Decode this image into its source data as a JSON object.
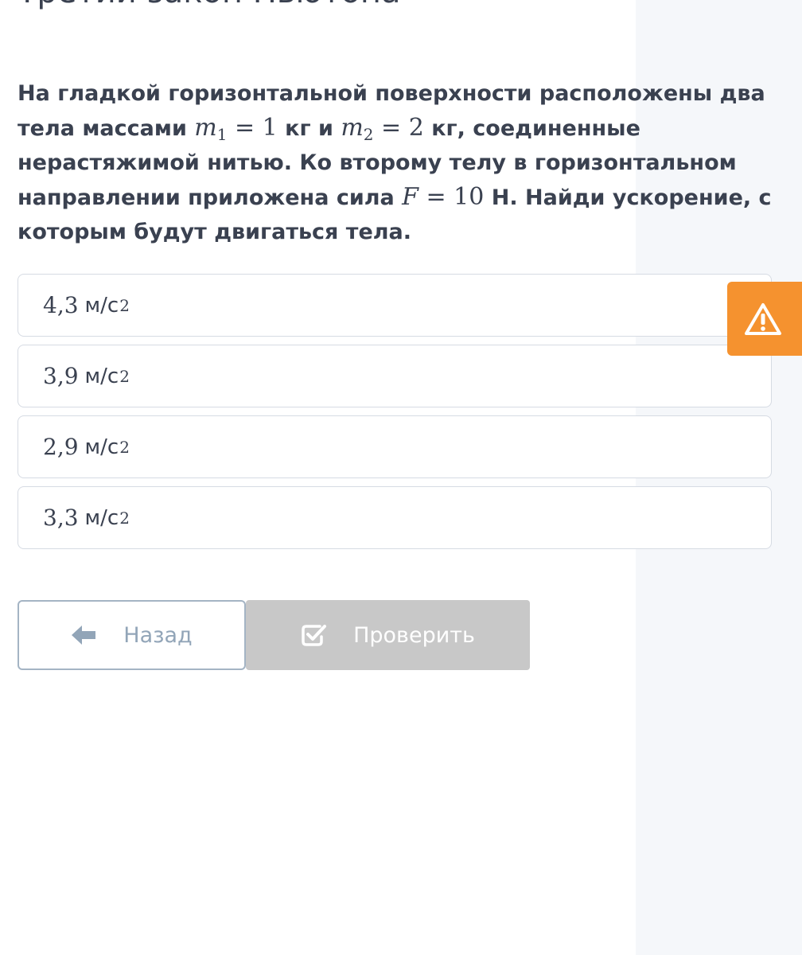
{
  "lesson": {
    "title": "Третий закон Ньютона"
  },
  "question": {
    "text_1": "На гладкой горизонтальной поверхности расположены два тела массами ",
    "m1_var": "m",
    "m1_sub": "1",
    "m1_eq": " = 1",
    "m1_unit": " кг и ",
    "m2_var": "m",
    "m2_sub": "2",
    "m2_eq": " = 2",
    "text_2": " кг, соединенные нерастяжимой нитью. Ко второму телу в горизонтальном направлении приложена сила ",
    "f_var": "F",
    "f_eq": " = 10",
    "text_3": " Н. Найди ускорение, с которым будут двигаться тела."
  },
  "options": [
    {
      "value": "4,3",
      "unit": "м/с",
      "power": "2"
    },
    {
      "value": "3,9",
      "unit": "м/с",
      "power": "2"
    },
    {
      "value": "2,9",
      "unit": "м/с",
      "power": "2"
    },
    {
      "value": "3,3",
      "unit": "м/с",
      "power": "2"
    }
  ],
  "buttons": {
    "back_label": "Назад",
    "check_label": "Проверить",
    "report_icon": "warning-icon"
  },
  "colors": {
    "accent_orange": "#f5922f",
    "disabled_gray": "#c8c8c8",
    "text": "#3a4150",
    "muted_blue": "#92a5b8"
  }
}
